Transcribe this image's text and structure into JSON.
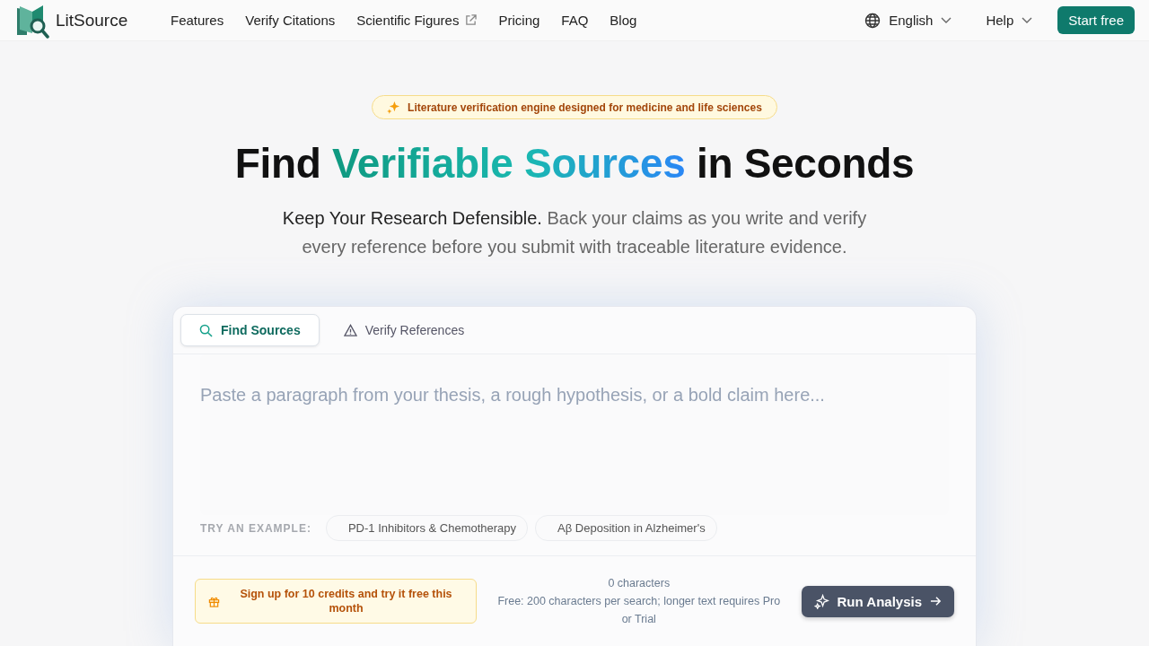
{
  "header": {
    "brand": "LitSource",
    "nav": [
      {
        "label": "Features",
        "external": false
      },
      {
        "label": "Verify Citations",
        "external": false
      },
      {
        "label": "Scientific Figures",
        "external": true
      },
      {
        "label": "Pricing",
        "external": false
      },
      {
        "label": "FAQ",
        "external": false
      },
      {
        "label": "Blog",
        "external": false
      }
    ],
    "language": "English",
    "help": "Help",
    "cta": "Start free"
  },
  "hero": {
    "badge": "Literature verification engine designed for medicine and life sciences",
    "title": [
      {
        "text": "Find ",
        "kind": "plain"
      },
      {
        "text": "Verifiable Sources",
        "kind": "highlight"
      },
      {
        "text": " in Seconds",
        "kind": "plain"
      }
    ],
    "subtitle_lead": "Keep Your Research Defensible.",
    "subtitle": "Back your claims as you write and verify every reference before you submit with traceable literature evidence."
  },
  "panel": {
    "tabs": [
      {
        "label": "Find Sources",
        "kind": "search",
        "selected": true
      },
      {
        "label": "Verify References",
        "kind": "warning",
        "selected": false
      }
    ],
    "placeholder": "Paste a paragraph from your thesis, a rough hypothesis, or a bold claim here...",
    "examples_label": "TRY AN EXAMPLE:",
    "examples": [
      "PD-1 Inhibitors & Chemotherapy",
      "Aβ Deposition in Alzheimer's"
    ],
    "promo": "Sign up for 10 credits and try it free this month",
    "char_count": "0 characters",
    "limit_note": "Free: 200 characters per search; longer text requires Pro or Trial",
    "run_button": "Run Analysis"
  }
}
